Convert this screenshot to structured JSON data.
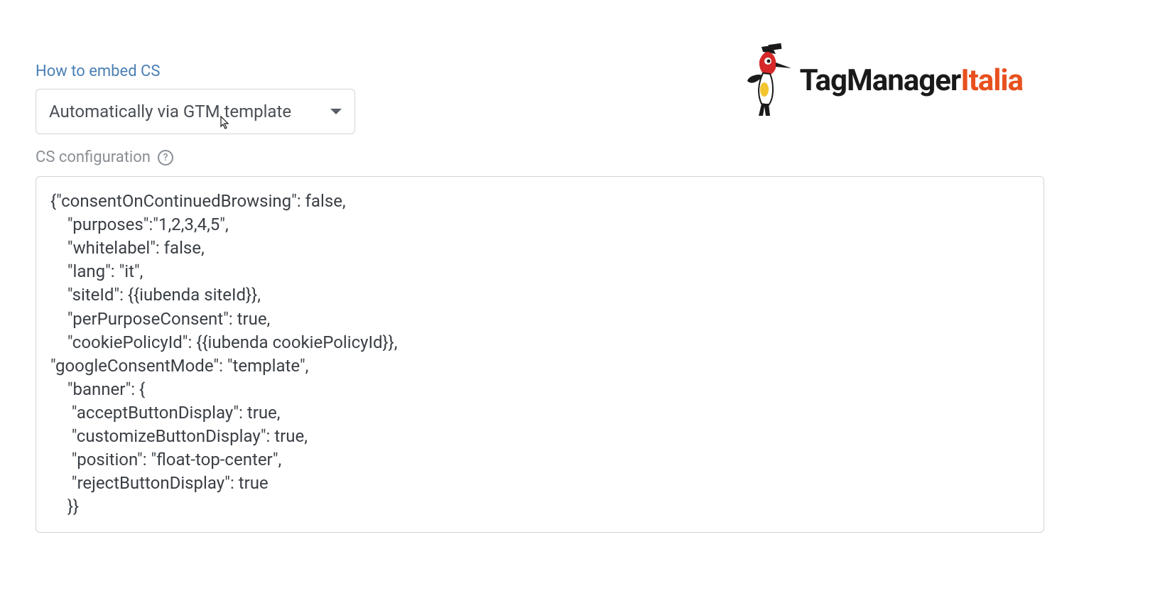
{
  "logo": {
    "text_part1": "TagManager",
    "text_part2": "Italia"
  },
  "form": {
    "embed_label": "How to embed CS",
    "dropdown_value": "Automatically via GTM template",
    "config_label": "CS configuration",
    "config_value": "{\"consentOnContinuedBrowsing\": false,\n    \"purposes\":\"1,2,3,4,5\",\n    \"whitelabel\": false,\n    \"lang\": \"it\",\n    \"siteId\": {{iubenda siteId}},\n    \"perPurposeConsent\": true,\n    \"cookiePolicyId\": {{iubenda cookiePolicyId}},\n\"googleConsentMode\": \"template\",\n    \"banner\": {\n     \"acceptButtonDisplay\": true,\n     \"customizeButtonDisplay\": true,\n     \"position\": \"float-top-center\",\n     \"rejectButtonDisplay\": true\n    }}"
  }
}
